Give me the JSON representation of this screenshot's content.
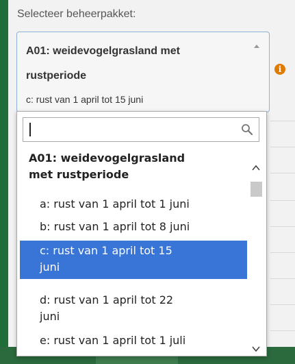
{
  "field_label": "Selecteer beheerpakket:",
  "selected": {
    "title": "A01: weidevogelgrasland met rustperiode",
    "title_line1": "A01: weidevogelgrasland met",
    "title_line2": "rustperiode",
    "subtitle": "c: rust van 1 april tot 15 juni"
  },
  "info_icon": "i",
  "search": {
    "value": "",
    "placeholder": ""
  },
  "group": {
    "label": "A01: weidevogelgrasland met rustperiode",
    "label_line1": "A01: weidevogelgrasland",
    "label_line2": "met rustperiode"
  },
  "options": [
    {
      "label": "a: rust van 1 april tot 1 juni",
      "line1": "a: rust van 1 april tot 1 juni",
      "line2": ""
    },
    {
      "label": "b: rust van 1 april tot 8 juni",
      "line1": "b: rust van 1 april tot 8 juni",
      "line2": ""
    },
    {
      "label": "c: rust van 1 april tot 15 juni",
      "line1": "c: rust van 1 april tot 15",
      "line2": "juni"
    },
    {
      "label": "d: rust van 1 april tot 22 juni",
      "line1": "d: rust van 1 april tot 22",
      "line2": "juni"
    },
    {
      "label": "e: rust van 1 april tot 1 juli",
      "line1": "e: rust van 1 april tot 1 juli",
      "line2": ""
    }
  ],
  "selected_option_index": 2,
  "colors": {
    "highlight": "#3875d7",
    "info": "#e07a00",
    "border_focus": "#8fb0d6"
  },
  "icons": {
    "info": "info-icon",
    "search": "search-icon",
    "collapse": "chevron-up-icon",
    "scroll_up": "chevron-up-icon",
    "scroll_down": "chevron-down-icon"
  }
}
